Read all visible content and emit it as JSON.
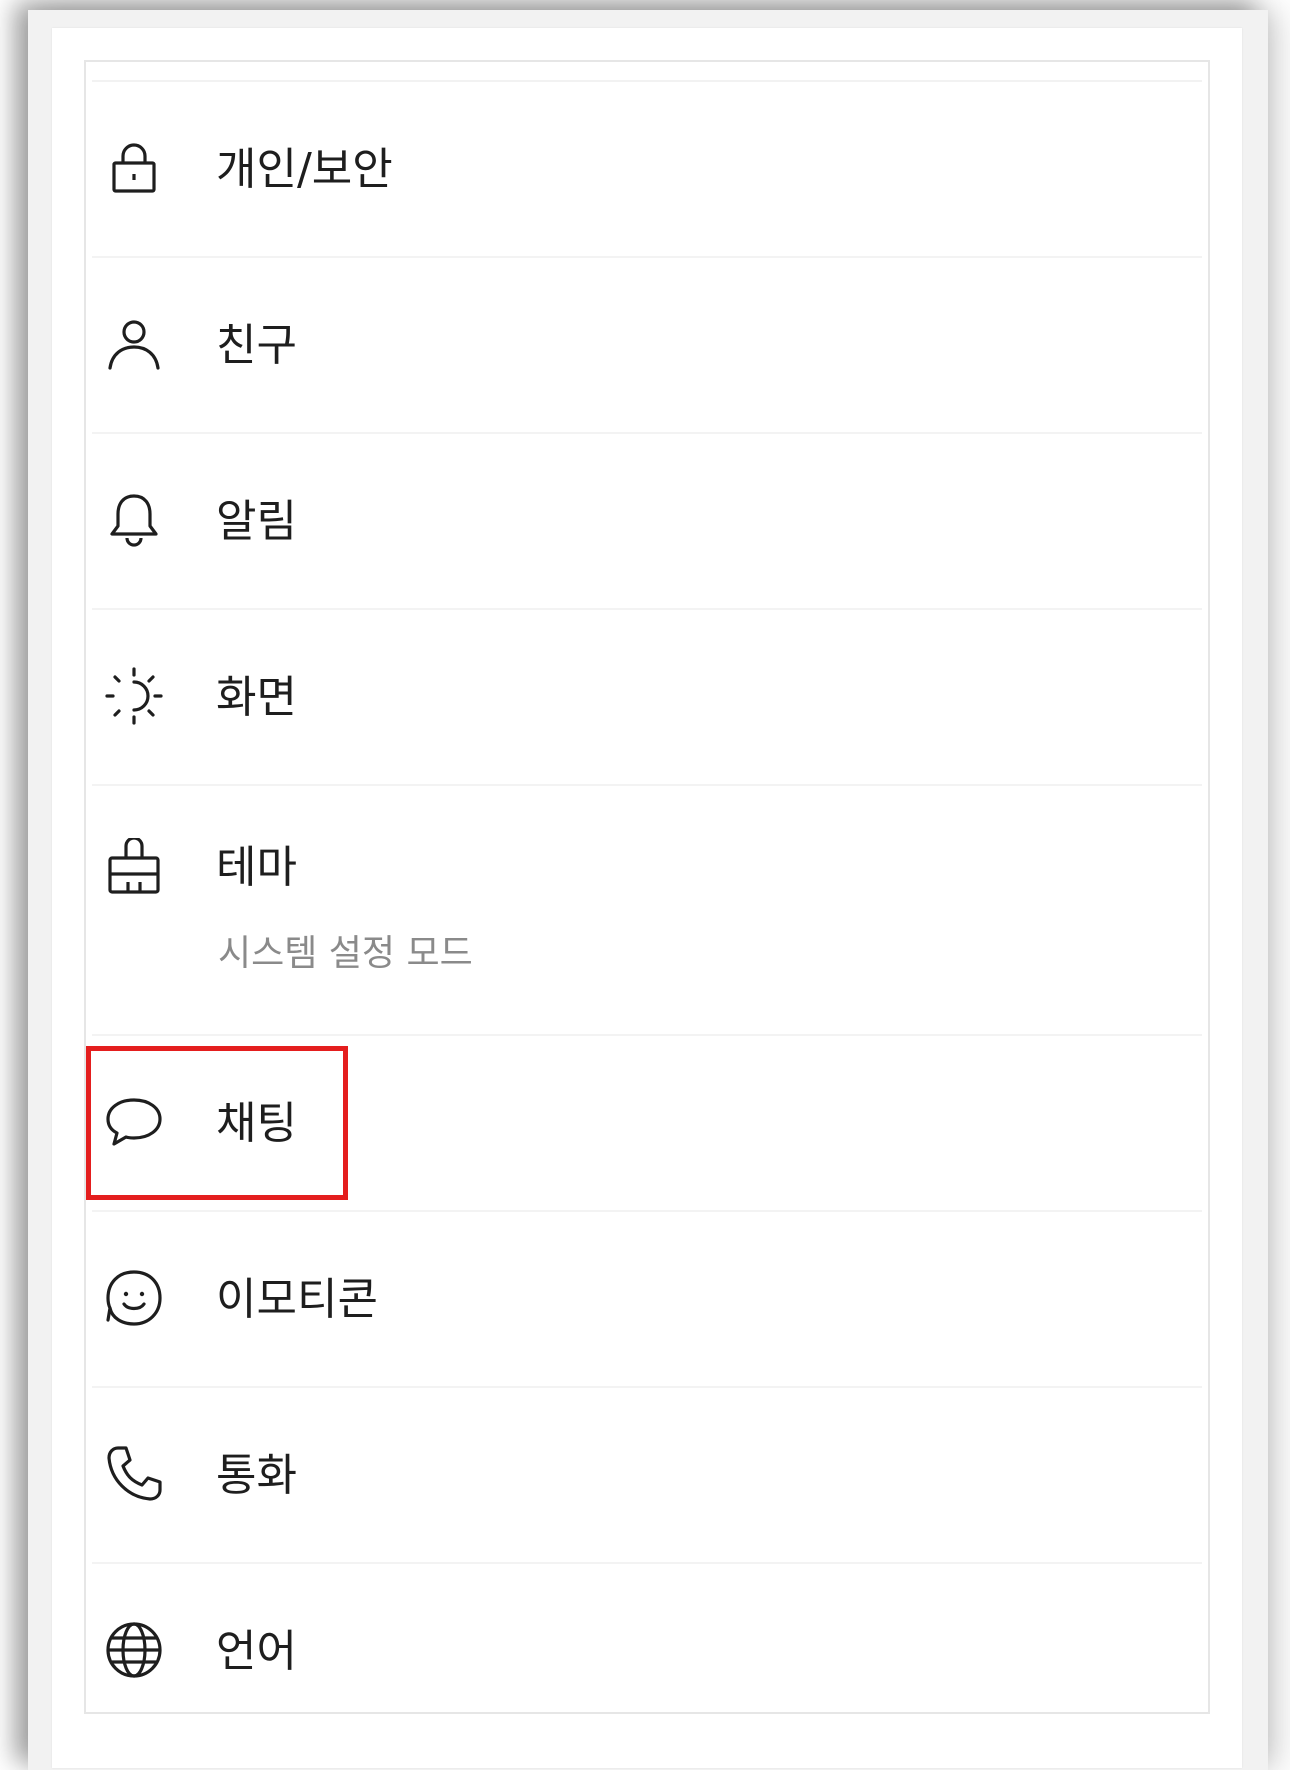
{
  "settings_menu": {
    "items": [
      {
        "icon": "lock-icon",
        "label": "개인/보안"
      },
      {
        "icon": "person-icon",
        "label": "친구"
      },
      {
        "icon": "bell-icon",
        "label": "알림"
      },
      {
        "icon": "brightness-icon",
        "label": "화면"
      },
      {
        "icon": "brush-icon",
        "label": "테마",
        "sublabel": "시스템 설정 모드"
      },
      {
        "icon": "chat-bubble-icon",
        "label": "채팅"
      },
      {
        "icon": "emoticon-icon",
        "label": "이모티콘"
      },
      {
        "icon": "phone-icon",
        "label": "통화"
      },
      {
        "icon": "globe-icon",
        "label": "언어"
      }
    ]
  },
  "highlight": {
    "target": "채팅",
    "color": "#e41e1e"
  }
}
